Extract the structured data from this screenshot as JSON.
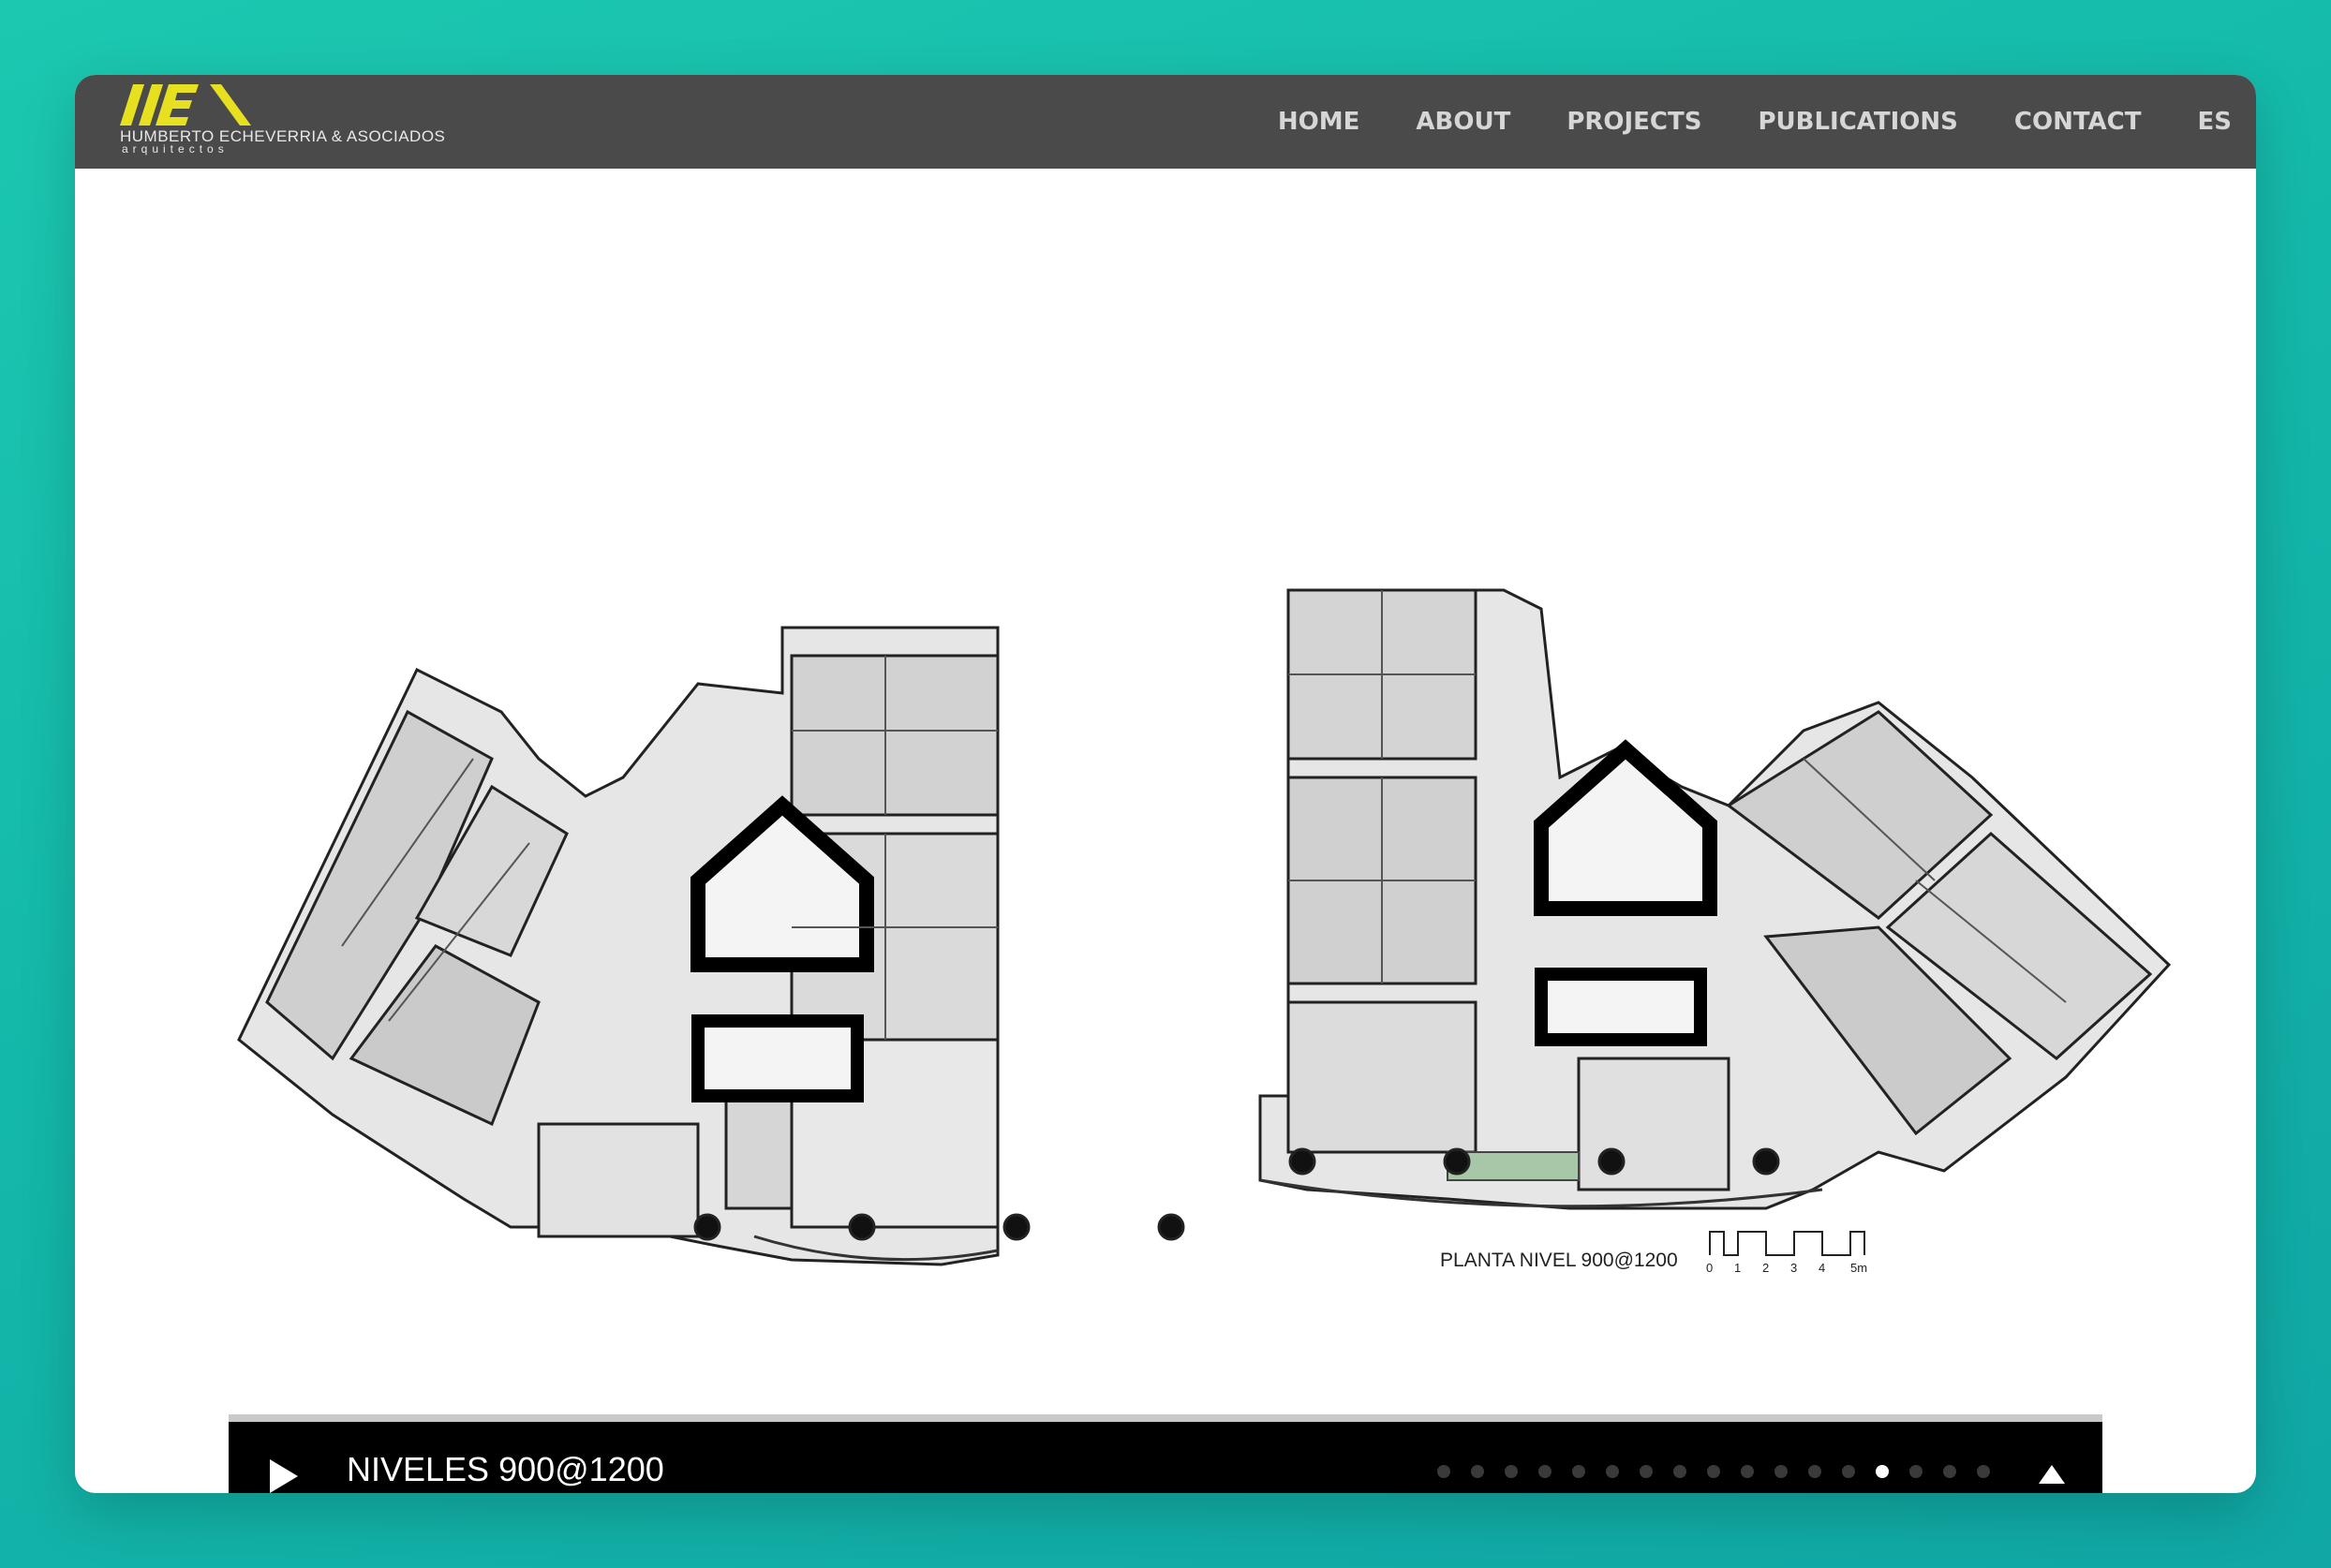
{
  "brand": {
    "name": "HUMBERTO ECHEVERRIA & ASOCIADOS",
    "sub": "arquitectos",
    "accent": "#e7e021"
  },
  "nav": {
    "items": [
      {
        "label": "HOME"
      },
      {
        "label": "ABOUT"
      },
      {
        "label": "PROJECTS"
      },
      {
        "label": "PUBLICATIONS"
      },
      {
        "label": "CONTACT"
      },
      {
        "label": "ES"
      }
    ]
  },
  "plan": {
    "label": "PLANTA NIVEL 900@1200",
    "scale_ticks": [
      "0",
      "1",
      "2",
      "3",
      "4",
      "5m"
    ]
  },
  "slideshow": {
    "title": "NIVELES 900@1200",
    "total_slides": 17,
    "active_slide": 14,
    "play_icon": "play-icon",
    "up_icon": "caret-up-icon"
  }
}
